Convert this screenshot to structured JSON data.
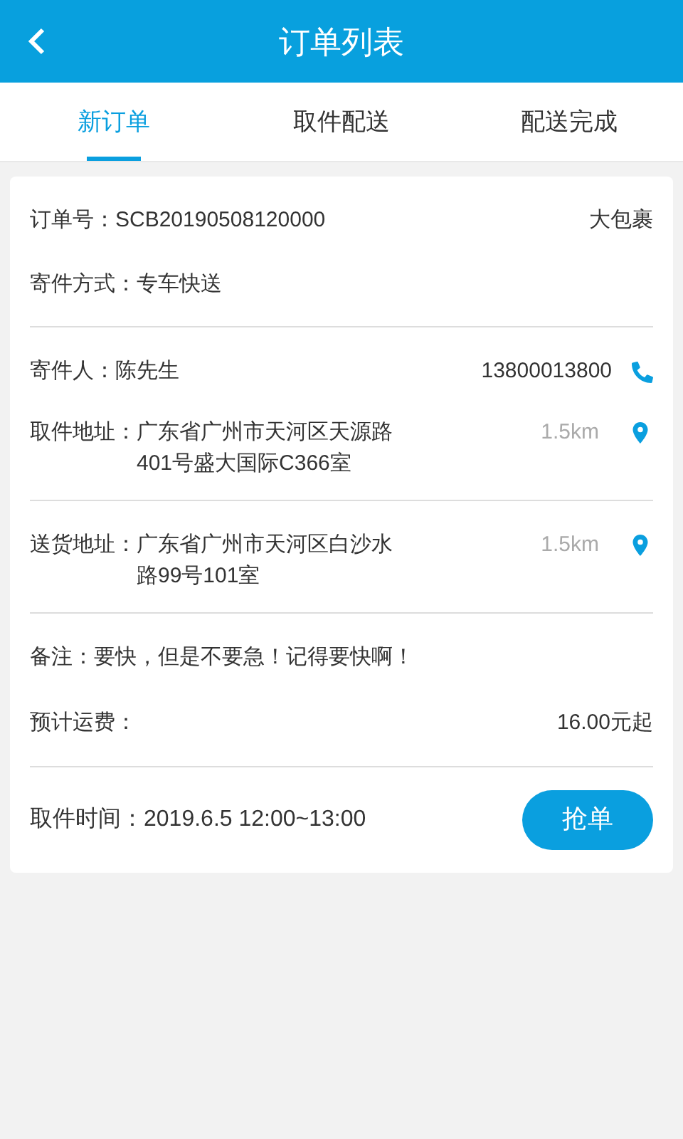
{
  "header": {
    "title": "订单列表"
  },
  "tabs": [
    {
      "label": "新订单",
      "selected": true
    },
    {
      "label": "取件配送",
      "selected": false
    },
    {
      "label": "配送完成",
      "selected": false
    }
  ],
  "order": {
    "number_label": "订单号：",
    "number": "SCB20190508120000",
    "package": "大包裹",
    "method_label": "寄件方式：",
    "method": "专车快送",
    "sender_label": "寄件人：",
    "sender": "陈先生",
    "phone": "13800013800",
    "pickup_label": "取件地址：",
    "pickup_address": "广东省广州市天河区天源路401号盛大国际C366室",
    "pickup_distance": "1.5km",
    "delivery_label": "送货地址：",
    "delivery_address": "广东省广州市天河区白沙水路99号101室",
    "delivery_distance": "1.5km",
    "note_label": "备注：",
    "note": "要快，但是不要急！记得要快啊！",
    "fee_label": "预计运费：",
    "fee": "16.00元起",
    "time_label": "取件时间：",
    "time": "2019.6.5 12:00~13:00",
    "grab_button": "抢单"
  }
}
